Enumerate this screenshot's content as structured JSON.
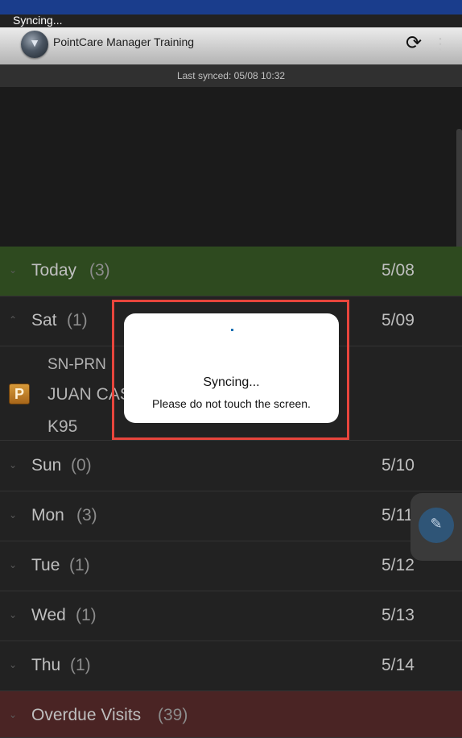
{
  "status_bar": {
    "sync_text": "Syncing..."
  },
  "header": {
    "app_title": "PointCare Manager Training",
    "icons": {
      "logo": "pointcare-logo",
      "sync": "sync-icon",
      "more": "more-vert-icon"
    }
  },
  "last_synced": "Last synced: 05/08 10:32",
  "days": [
    {
      "name": "Today",
      "count": "(3)",
      "date": "5/08",
      "expanded": false,
      "color": "#2e4a1f"
    },
    {
      "name": "Sat",
      "count": "(1)",
      "date": "5/09",
      "expanded": true
    },
    {
      "name": "Sun",
      "count": "(0)",
      "date": "5/10",
      "expanded": false
    },
    {
      "name": "Mon",
      "count": "(3)",
      "date": "5/11",
      "expanded": false
    },
    {
      "name": "Tue",
      "count": "(1)",
      "date": "5/12",
      "expanded": false
    },
    {
      "name": "Wed",
      "count": "(1)",
      "date": "5/13",
      "expanded": false
    },
    {
      "name": "Thu",
      "count": "(1)",
      "date": "5/14",
      "expanded": false
    }
  ],
  "visit": {
    "badge": "P",
    "type": "SN-PRN",
    "patient": "JUAN CAS",
    "code": "K95"
  },
  "overdue": {
    "name": "Overdue Visits",
    "count": "(39)",
    "color": "#4a2424"
  },
  "dialog": {
    "title": "Syncing...",
    "message": "Please do not touch the screen."
  },
  "colors": {
    "highlight": "#e8453c",
    "background": "#222222",
    "today_row": "#2e4a1f",
    "overdue_row": "#4a2424"
  }
}
